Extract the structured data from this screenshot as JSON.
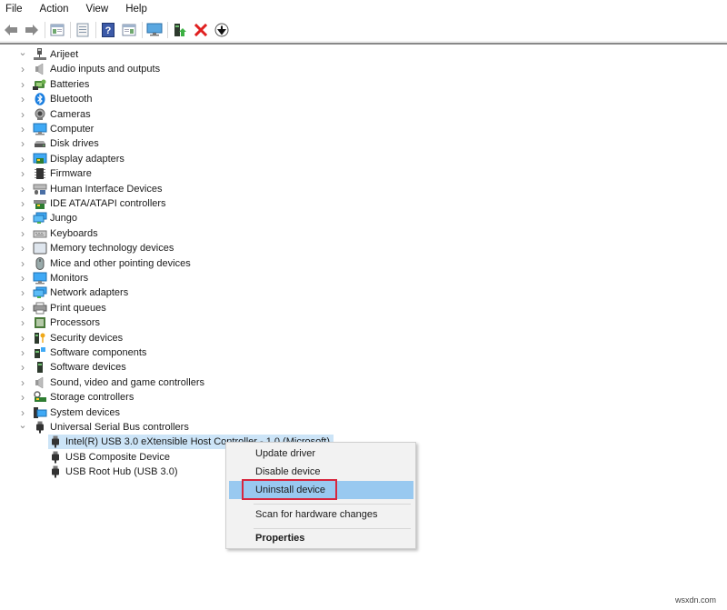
{
  "menubar": [
    "File",
    "Action",
    "View",
    "Help"
  ],
  "toolbar": {
    "buttons": [
      {
        "name": "back-button",
        "icon": "arrow-left-icon"
      },
      {
        "name": "forward-button",
        "icon": "arrow-right-icon"
      },
      {
        "name": "show-hide-console-tree-button",
        "icon": "console-tree-icon"
      },
      {
        "name": "properties-button",
        "icon": "properties-icon"
      },
      {
        "name": "help-button",
        "icon": "help-icon"
      },
      {
        "name": "show-hide-action-pane-button",
        "icon": "action-pane-icon"
      },
      {
        "name": "scan-hardware-button",
        "icon": "monitor-scan-icon"
      },
      {
        "name": "update-driver-button",
        "icon": "update-driver-icon"
      },
      {
        "name": "uninstall-button",
        "icon": "red-x-icon"
      },
      {
        "name": "enable-device-button",
        "icon": "down-arrow-circle-icon"
      }
    ]
  },
  "tree": {
    "root": {
      "label": "Arijeet",
      "icon": "computer-network-icon",
      "expanded": true
    },
    "categories": [
      {
        "label": "Audio inputs and outputs",
        "icon": "speaker-icon"
      },
      {
        "label": "Batteries",
        "icon": "battery-icon"
      },
      {
        "label": "Bluetooth",
        "icon": "bluetooth-icon"
      },
      {
        "label": "Cameras",
        "icon": "camera-icon"
      },
      {
        "label": "Computer",
        "icon": "computer-icon"
      },
      {
        "label": "Disk drives",
        "icon": "disk-drive-icon"
      },
      {
        "label": "Display adapters",
        "icon": "display-adapter-icon"
      },
      {
        "label": "Firmware",
        "icon": "firmware-chip-icon"
      },
      {
        "label": "Human Interface Devices",
        "icon": "hid-icon"
      },
      {
        "label": "IDE ATA/ATAPI controllers",
        "icon": "ide-controller-icon"
      },
      {
        "label": "Jungo",
        "icon": "network-icon"
      },
      {
        "label": "Keyboards",
        "icon": "keyboard-icon"
      },
      {
        "label": "Memory technology devices",
        "icon": "memory-icon"
      },
      {
        "label": "Mice and other pointing devices",
        "icon": "mouse-icon"
      },
      {
        "label": "Monitors",
        "icon": "monitor-icon"
      },
      {
        "label": "Network adapters",
        "icon": "network-adapter-icon"
      },
      {
        "label": "Print queues",
        "icon": "printer-icon"
      },
      {
        "label": "Processors",
        "icon": "processor-icon"
      },
      {
        "label": "Security devices",
        "icon": "security-key-icon"
      },
      {
        "label": "Software components",
        "icon": "software-component-icon"
      },
      {
        "label": "Software devices",
        "icon": "software-device-icon"
      },
      {
        "label": "Sound, video and game controllers",
        "icon": "speaker-icon"
      },
      {
        "label": "Storage controllers",
        "icon": "storage-controller-icon"
      },
      {
        "label": "System devices",
        "icon": "system-devices-icon"
      },
      {
        "label": "Universal Serial Bus controllers",
        "icon": "usb-plug-icon",
        "expanded": true,
        "children": [
          {
            "label": "Intel(R) USB 3.0 eXtensible Host Controller - 1.0 (Microsoft)",
            "icon": "usb-plug-icon",
            "selected": true
          },
          {
            "label": "USB Composite Device",
            "icon": "usb-plug-icon"
          },
          {
            "label": "USB Root Hub (USB 3.0)",
            "icon": "usb-plug-icon"
          }
        ]
      }
    ]
  },
  "context_menu": {
    "items": [
      {
        "label": "Update driver"
      },
      {
        "label": "Disable device"
      },
      {
        "label": "Uninstall device",
        "highlighted": true,
        "annotated": true
      },
      {
        "label": "Scan for hardware changes"
      },
      {
        "label": "Properties",
        "bold": true
      }
    ],
    "highlight_color": "#99c9f0",
    "annotation_color": "#d7263d"
  },
  "watermark": "wsxdn.com"
}
